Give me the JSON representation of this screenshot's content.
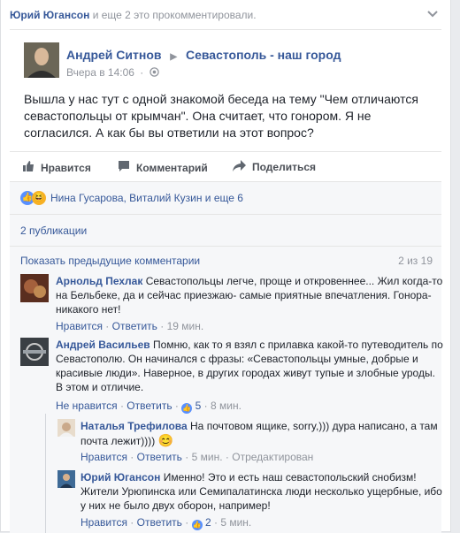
{
  "topbar": {
    "names": "Юрий Югансон",
    "rest": "и еще 2 это прокомментировали."
  },
  "post": {
    "author": "Андрей Ситнов",
    "group": "Севастополь - наш город",
    "time": "Вчера в 14:06",
    "text": "Вышла у нас тут с одной знакомой беседа на тему \"Чем отличаются севастопольцы от крымчан\". Она считает, что гонором. Я не согласился. А как бы вы ответили на этот вопрос?"
  },
  "actions": {
    "like": "Нравится",
    "comment": "Комментарий",
    "share": "Поделиться"
  },
  "reactions": {
    "names": "Нина Гусарова, Виталий Кузин и еще 6"
  },
  "shares_label": "2 публикации",
  "prev_comments": {
    "label": "Показать предыдущие комментарии",
    "count": "2 из 19"
  },
  "comments": [
    {
      "author": "Арнольд Пехлак",
      "text": "Севастопольцы легче, проще и откровеннее... Жил когда-то на Бельбеке, да и сейчас приезжаю- самые приятные впечатления. Гонора- никакого нет!",
      "like": "Нравится",
      "reply": "Ответить",
      "time": "19 мин."
    },
    {
      "author": "Андрей Васильев",
      "text": "Помню, как то я взял с прилавка какой-то путеводитель по Севастополю. Он начинался с фразы: «Севастопольцы умные, добрые и красивые люди». Наверное, в других городах живут тупые и злобные уроды. В этом и отличие.",
      "like": "Не нравится",
      "reply": "Ответить",
      "likes": "5",
      "time": "8 мин."
    }
  ],
  "replies": [
    {
      "author": "Наталья Трефилова",
      "text": "На почтовом ящике, sorry,))) дура написано, а там почта лежит))))",
      "like": "Нравится",
      "reply": "Ответить",
      "time": "5 мин.",
      "edited": "Отредактирован"
    },
    {
      "author": "Юрий Югансон",
      "text": "Именно! Это и есть наш севастопольский снобизм! Жители Урюпинска или Семипалатинска люди несколько ущербные, ибо у них не было двух оборон, например!",
      "like": "Нравится",
      "reply": "Ответить",
      "likes": "2",
      "time": "5 мин."
    }
  ],
  "colors": {
    "link": "#365899",
    "muted": "#90949c",
    "like_blue": "#5890ff",
    "haha_yellow": "#f7b125"
  }
}
